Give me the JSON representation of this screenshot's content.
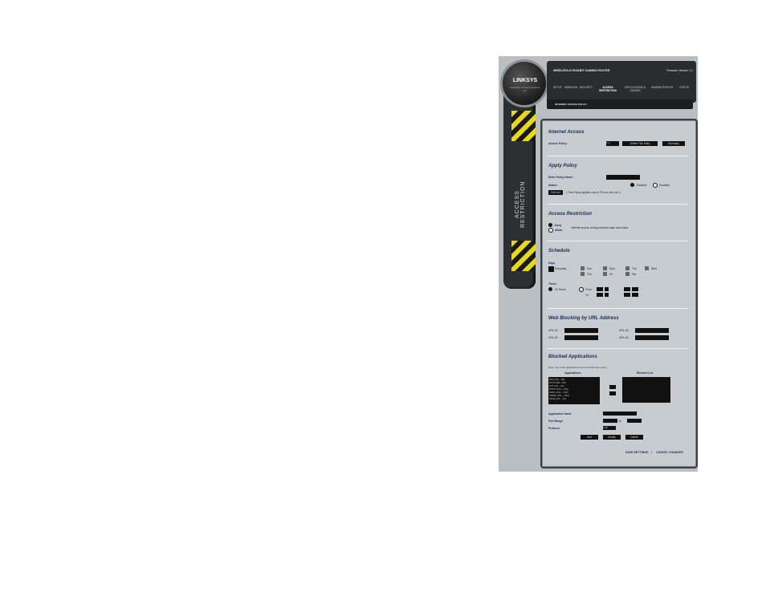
{
  "brand": {
    "logo": "LINKSYS",
    "logo_sub": "A Division of Cisco Systems, Inc.",
    "side_label": "ACCESS RESTRICTION"
  },
  "header": {
    "product": "WIRELESS-N GIGABIT GAMING ROUTER",
    "firmware": "Firmware Version: 1.1"
  },
  "nav": [
    {
      "label": "SETUP"
    },
    {
      "label": "WIRELESS"
    },
    {
      "label": "SECURITY"
    },
    {
      "label": "ACCESS RESTRICTION"
    },
    {
      "label": "APPLICATIONS & GAMING"
    },
    {
      "label": "ADMINISTRATION"
    },
    {
      "label": "STATUS"
    }
  ],
  "subnav": "INTERNET ACCESS POLICY",
  "internet_access": {
    "title": "Internet Access",
    "policy_label": "Access Policy :",
    "policy_value": "1 ()",
    "delete_btn": "Delete This Entry",
    "summary_btn": "Summary"
  },
  "apply_policy": {
    "title": "Apply Policy",
    "name_label": "Enter Policy Name :",
    "status_label": "Status :",
    "enabled": "Enabled",
    "disabled": "Disabled",
    "edit_btn": "Edit List",
    "note": "( This Policy applies only to PCs on the List. )"
  },
  "access_restriction": {
    "title": "Access Restriction",
    "deny": "Deny",
    "allow": "Allow",
    "desc": "Internet access during selected days and hours."
  },
  "schedule": {
    "title": "Schedule",
    "days_label": "Days",
    "everyday": "Everyday",
    "days": [
      "Sun",
      "Mon",
      "Tue",
      "Wed",
      "Thu",
      "Fri",
      "Sat"
    ],
    "times_label": "Times",
    "hours24": "24 Hours",
    "from": "From :",
    "to": "To :"
  },
  "url_block": {
    "title": "Web Blocking by URL Address",
    "url1": "URL #1 :",
    "url2": "URL #2 :",
    "url3": "URL #3 :",
    "url4": "URL #4 :"
  },
  "blocked_apps": {
    "title": "Blocked Applications",
    "note": "Note: only three applications can be blocked per policy.",
    "apps_header": "Applications",
    "blocked_header": "Blocked List",
    "apps": [
      "DNS (53 ~ 53)",
      "HTTP (80 ~ 80)",
      "FTP (21 ~ 21)",
      "POP3 (110 ~ 110)",
      "IMAP (143 ~ 143)",
      "SNMP (161 ~ 161)",
      "Telnet (23 ~ 23)"
    ],
    "app_name_label": "Application Name",
    "port_range_label": "Port Range",
    "to_label": "to",
    "protocol_label": "Protocol",
    "protocol_value": "TCP",
    "add_btn": "Add",
    "modify_btn": "Modify",
    "delete_btn": "Delete"
  },
  "footer": {
    "save": "SAVE SETTINGS",
    "cancel": "CANCEL CHANGES",
    "separator": "|"
  }
}
